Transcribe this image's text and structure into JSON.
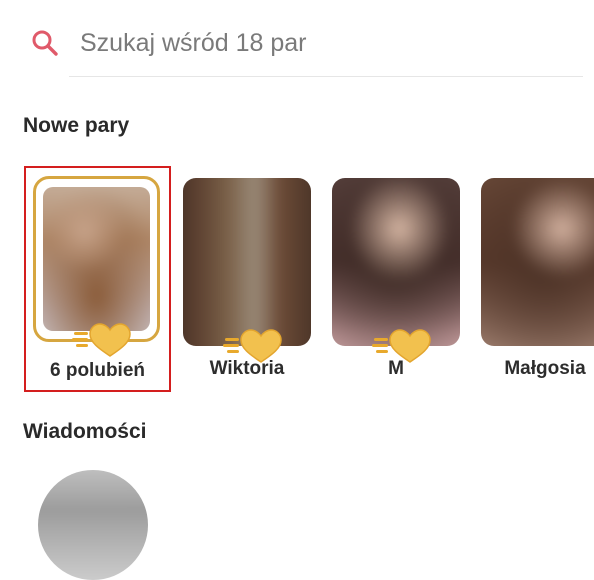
{
  "search": {
    "placeholder": "Szukaj wśród 18 par",
    "value": "",
    "icon": "search-icon",
    "icon_color": "#e05a6a"
  },
  "sections": {
    "new_matches_title": "Nowe pary",
    "messages_title": "Wiadomości"
  },
  "likes_card": {
    "label": "6 polubień",
    "highlight_color": "#d41e1e",
    "frame_color": "#d6a640",
    "icon": "gold-heart-icon"
  },
  "matches": [
    {
      "name": "Wiktoria",
      "icon": "gold-heart-icon"
    },
    {
      "name": "M",
      "icon": "gold-heart-icon"
    },
    {
      "name": "Małgosia"
    }
  ],
  "colors": {
    "gold": "#f2c14e",
    "gold_dark": "#e3a52e",
    "text": "#2d2d2d"
  }
}
